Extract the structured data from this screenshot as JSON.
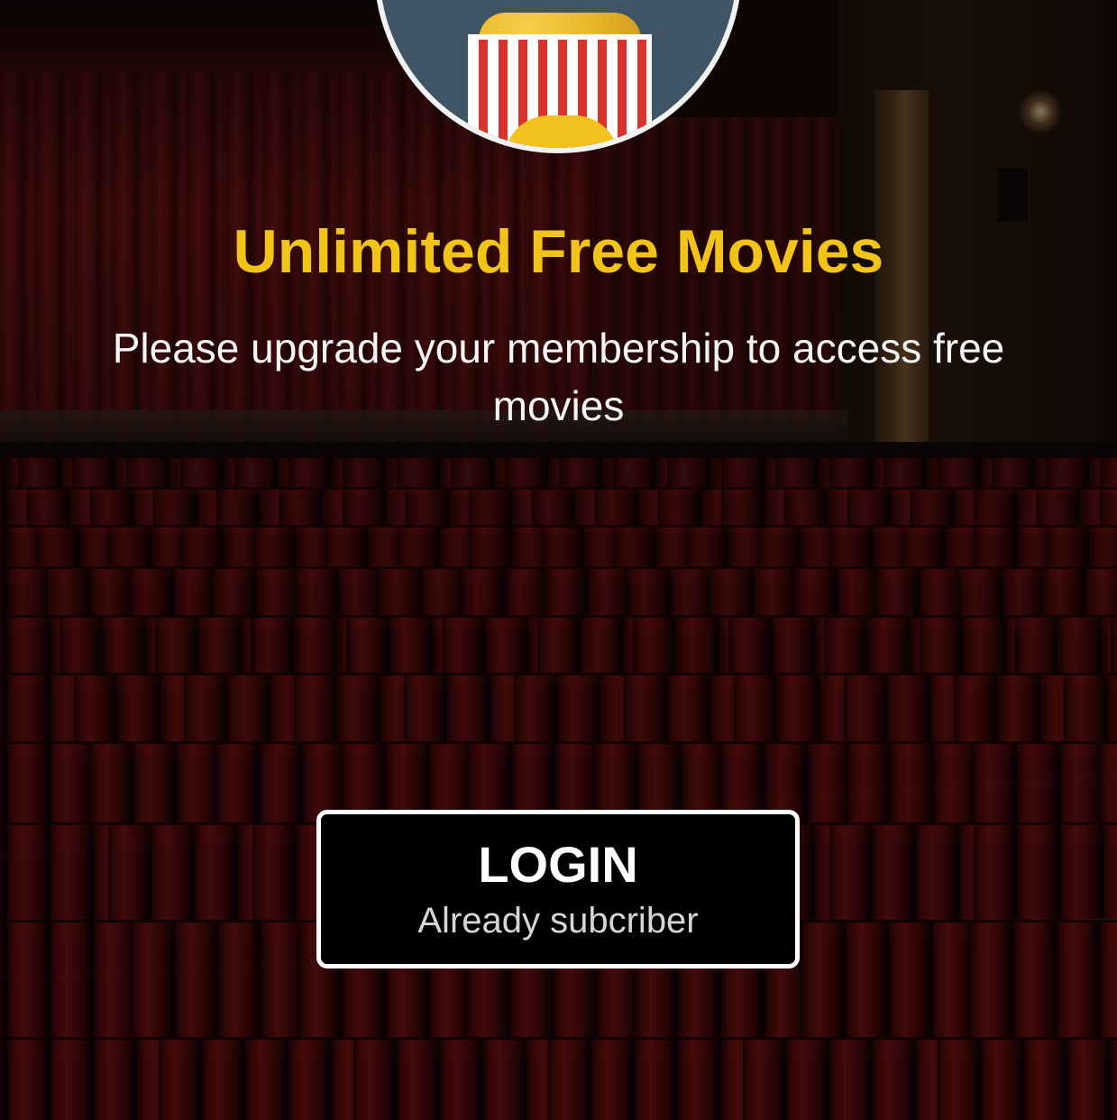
{
  "promo": {
    "headline": "Unlimited Free Movies",
    "subtitle": "Please upgrade your membership to access free movies"
  },
  "login_button": {
    "label": "LOGIN",
    "sublabel": "Already subcriber"
  },
  "logo": {
    "icon": "popcorn-icon"
  },
  "colors": {
    "headline": "#f2c418",
    "button_background": "#000000",
    "button_border": "#ffffff",
    "logo_background": "#3f5566"
  }
}
